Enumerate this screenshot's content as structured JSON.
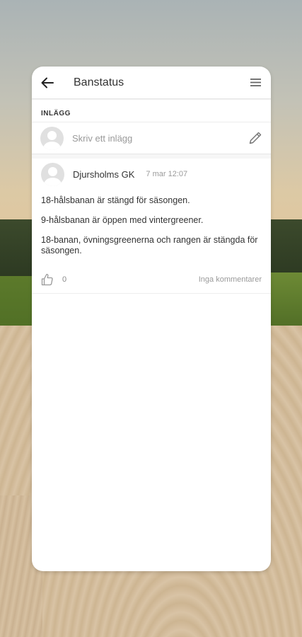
{
  "header": {
    "title": "Banstatus",
    "back_icon": "arrow-left-icon",
    "menu_icon": "hamburger-menu-icon"
  },
  "section": {
    "label": "INLÄGG"
  },
  "compose": {
    "placeholder": "Skriv ett inlägg",
    "edit_icon": "pencil-icon"
  },
  "post": {
    "author": "Djursholms GK",
    "timestamp": "7 mar 12:07",
    "paragraphs": [
      "18-hålsbanan är stängd för säsongen.",
      "9-hålsbanan är öppen med vintergreener.",
      "18-banan, övningsgreenerna och rangen är stängda för säsongen."
    ],
    "like_icon": "thumbs-up-icon",
    "likes": "0",
    "comments": "Inga kommentarer"
  }
}
